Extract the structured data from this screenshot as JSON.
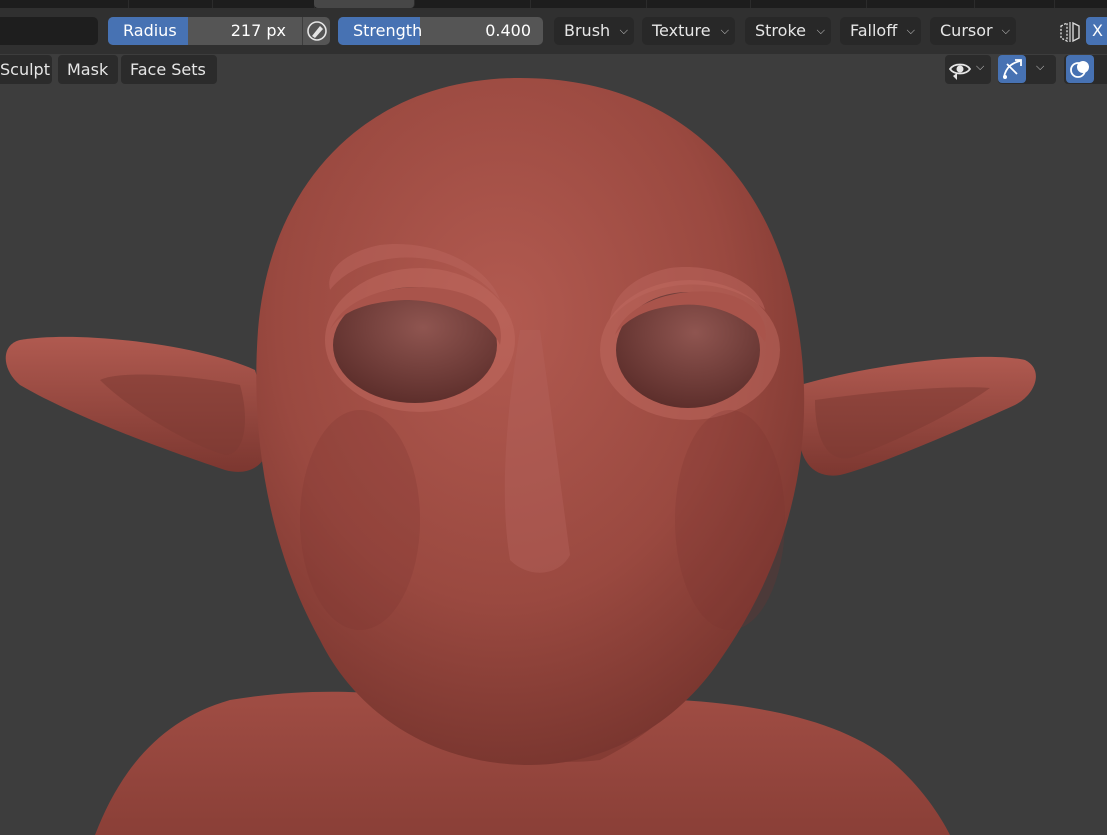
{
  "header": {
    "radius": {
      "label": "Radius",
      "value": "217 px",
      "fill_fraction": 0.35
    },
    "strength": {
      "label": "Strength",
      "value": "0.400",
      "fill_fraction": 0.4
    },
    "menus": [
      {
        "label": "Brush"
      },
      {
        "label": "Texture"
      },
      {
        "label": "Stroke"
      },
      {
        "label": "Falloff"
      },
      {
        "label": "Cursor"
      }
    ],
    "symmetry_axis": "X"
  },
  "mode_menus": [
    {
      "label": "Sculpt"
    },
    {
      "label": "Mask"
    },
    {
      "label": "Face Sets"
    }
  ],
  "viewport": {
    "object": "sculpted-goblin-head",
    "material_color": "#9c4a41",
    "background_color": "#3d3d3d"
  },
  "colors": {
    "accent": "#4772b3",
    "field": "#555555",
    "button": "#282828",
    "header": "#303030"
  },
  "icons": [
    "pressure-pen-icon",
    "symmetry-mirror-icon",
    "visibility-eye-icon",
    "gizmo-icon",
    "overlay-icon"
  ]
}
